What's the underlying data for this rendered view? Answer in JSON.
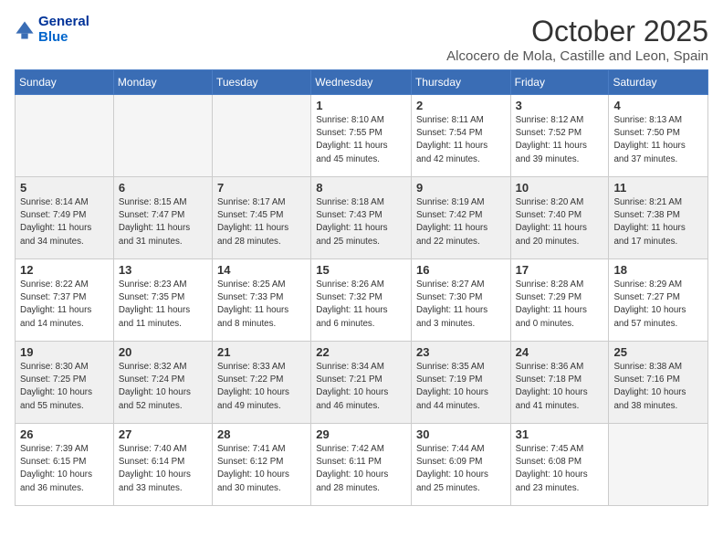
{
  "header": {
    "logo_line1": "General",
    "logo_line2": "Blue",
    "month_title": "October 2025",
    "location": "Alcocero de Mola, Castille and Leon, Spain"
  },
  "weekdays": [
    "Sunday",
    "Monday",
    "Tuesday",
    "Wednesday",
    "Thursday",
    "Friday",
    "Saturday"
  ],
  "weeks": [
    [
      {
        "day": "",
        "info": ""
      },
      {
        "day": "",
        "info": ""
      },
      {
        "day": "",
        "info": ""
      },
      {
        "day": "1",
        "info": "Sunrise: 8:10 AM\nSunset: 7:55 PM\nDaylight: 11 hours\nand 45 minutes."
      },
      {
        "day": "2",
        "info": "Sunrise: 8:11 AM\nSunset: 7:54 PM\nDaylight: 11 hours\nand 42 minutes."
      },
      {
        "day": "3",
        "info": "Sunrise: 8:12 AM\nSunset: 7:52 PM\nDaylight: 11 hours\nand 39 minutes."
      },
      {
        "day": "4",
        "info": "Sunrise: 8:13 AM\nSunset: 7:50 PM\nDaylight: 11 hours\nand 37 minutes."
      }
    ],
    [
      {
        "day": "5",
        "info": "Sunrise: 8:14 AM\nSunset: 7:49 PM\nDaylight: 11 hours\nand 34 minutes."
      },
      {
        "day": "6",
        "info": "Sunrise: 8:15 AM\nSunset: 7:47 PM\nDaylight: 11 hours\nand 31 minutes."
      },
      {
        "day": "7",
        "info": "Sunrise: 8:17 AM\nSunset: 7:45 PM\nDaylight: 11 hours\nand 28 minutes."
      },
      {
        "day": "8",
        "info": "Sunrise: 8:18 AM\nSunset: 7:43 PM\nDaylight: 11 hours\nand 25 minutes."
      },
      {
        "day": "9",
        "info": "Sunrise: 8:19 AM\nSunset: 7:42 PM\nDaylight: 11 hours\nand 22 minutes."
      },
      {
        "day": "10",
        "info": "Sunrise: 8:20 AM\nSunset: 7:40 PM\nDaylight: 11 hours\nand 20 minutes."
      },
      {
        "day": "11",
        "info": "Sunrise: 8:21 AM\nSunset: 7:38 PM\nDaylight: 11 hours\nand 17 minutes."
      }
    ],
    [
      {
        "day": "12",
        "info": "Sunrise: 8:22 AM\nSunset: 7:37 PM\nDaylight: 11 hours\nand 14 minutes."
      },
      {
        "day": "13",
        "info": "Sunrise: 8:23 AM\nSunset: 7:35 PM\nDaylight: 11 hours\nand 11 minutes."
      },
      {
        "day": "14",
        "info": "Sunrise: 8:25 AM\nSunset: 7:33 PM\nDaylight: 11 hours\nand 8 minutes."
      },
      {
        "day": "15",
        "info": "Sunrise: 8:26 AM\nSunset: 7:32 PM\nDaylight: 11 hours\nand 6 minutes."
      },
      {
        "day": "16",
        "info": "Sunrise: 8:27 AM\nSunset: 7:30 PM\nDaylight: 11 hours\nand 3 minutes."
      },
      {
        "day": "17",
        "info": "Sunrise: 8:28 AM\nSunset: 7:29 PM\nDaylight: 11 hours\nand 0 minutes."
      },
      {
        "day": "18",
        "info": "Sunrise: 8:29 AM\nSunset: 7:27 PM\nDaylight: 10 hours\nand 57 minutes."
      }
    ],
    [
      {
        "day": "19",
        "info": "Sunrise: 8:30 AM\nSunset: 7:25 PM\nDaylight: 10 hours\nand 55 minutes."
      },
      {
        "day": "20",
        "info": "Sunrise: 8:32 AM\nSunset: 7:24 PM\nDaylight: 10 hours\nand 52 minutes."
      },
      {
        "day": "21",
        "info": "Sunrise: 8:33 AM\nSunset: 7:22 PM\nDaylight: 10 hours\nand 49 minutes."
      },
      {
        "day": "22",
        "info": "Sunrise: 8:34 AM\nSunset: 7:21 PM\nDaylight: 10 hours\nand 46 minutes."
      },
      {
        "day": "23",
        "info": "Sunrise: 8:35 AM\nSunset: 7:19 PM\nDaylight: 10 hours\nand 44 minutes."
      },
      {
        "day": "24",
        "info": "Sunrise: 8:36 AM\nSunset: 7:18 PM\nDaylight: 10 hours\nand 41 minutes."
      },
      {
        "day": "25",
        "info": "Sunrise: 8:38 AM\nSunset: 7:16 PM\nDaylight: 10 hours\nand 38 minutes."
      }
    ],
    [
      {
        "day": "26",
        "info": "Sunrise: 7:39 AM\nSunset: 6:15 PM\nDaylight: 10 hours\nand 36 minutes."
      },
      {
        "day": "27",
        "info": "Sunrise: 7:40 AM\nSunset: 6:14 PM\nDaylight: 10 hours\nand 33 minutes."
      },
      {
        "day": "28",
        "info": "Sunrise: 7:41 AM\nSunset: 6:12 PM\nDaylight: 10 hours\nand 30 minutes."
      },
      {
        "day": "29",
        "info": "Sunrise: 7:42 AM\nSunset: 6:11 PM\nDaylight: 10 hours\nand 28 minutes."
      },
      {
        "day": "30",
        "info": "Sunrise: 7:44 AM\nSunset: 6:09 PM\nDaylight: 10 hours\nand 25 minutes."
      },
      {
        "day": "31",
        "info": "Sunrise: 7:45 AM\nSunset: 6:08 PM\nDaylight: 10 hours\nand 23 minutes."
      },
      {
        "day": "",
        "info": ""
      }
    ]
  ]
}
